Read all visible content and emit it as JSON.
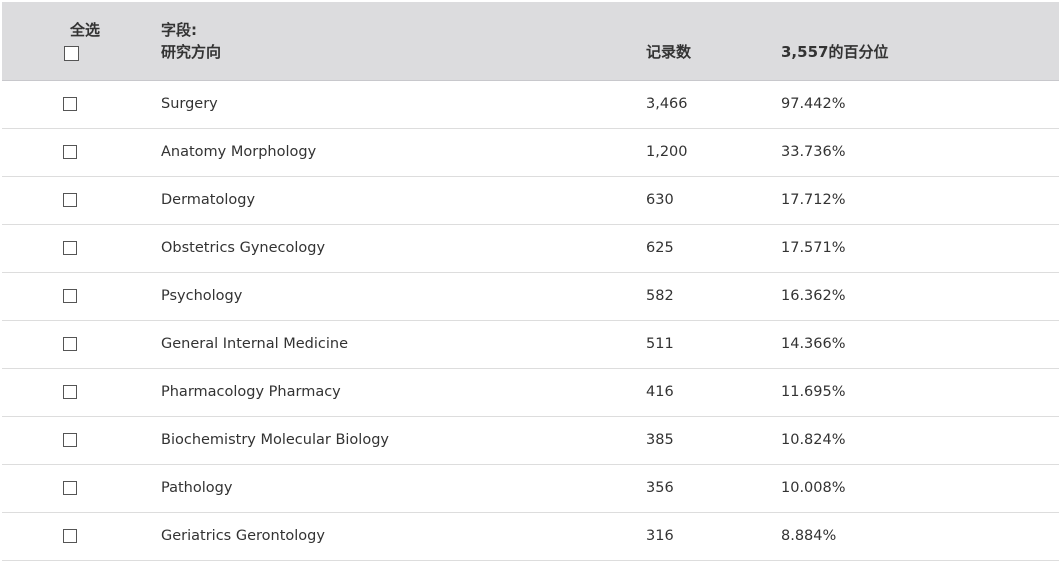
{
  "header": {
    "select_all": "全选",
    "field_label": "字段:",
    "field_name": "研究方向",
    "count_label": "记录数",
    "pct_label": "3,557的百分位"
  },
  "rows": [
    {
      "name": "Surgery",
      "count": "3,466",
      "pct": "97.442%"
    },
    {
      "name": "Anatomy Morphology",
      "count": "1,200",
      "pct": "33.736%"
    },
    {
      "name": "Dermatology",
      "count": "630",
      "pct": "17.712%"
    },
    {
      "name": "Obstetrics Gynecology",
      "count": "625",
      "pct": "17.571%"
    },
    {
      "name": "Psychology",
      "count": "582",
      "pct": "16.362%"
    },
    {
      "name": "General Internal Medicine",
      "count": "511",
      "pct": "14.366%"
    },
    {
      "name": "Pharmacology Pharmacy",
      "count": "416",
      "pct": "11.695%"
    },
    {
      "name": "Biochemistry Molecular Biology",
      "count": "385",
      "pct": "10.824%"
    },
    {
      "name": "Pathology",
      "count": "356",
      "pct": "10.008%"
    },
    {
      "name": "Geriatrics Gerontology",
      "count": "316",
      "pct": "8.884%"
    }
  ]
}
